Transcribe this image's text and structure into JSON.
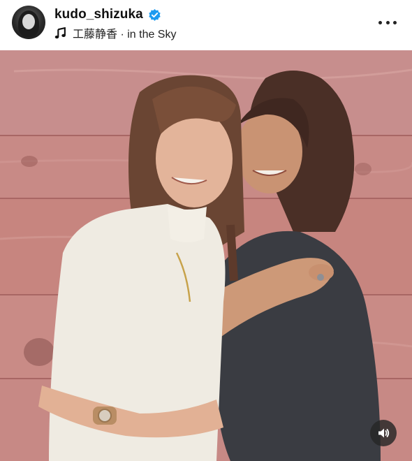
{
  "post": {
    "username": "kudo_shizuka",
    "music": "工藤静香 · in the Sky",
    "verified": true
  },
  "icons": {
    "avatar": "profile-avatar",
    "verified": "verified-badge-icon",
    "music": "music-note-icon",
    "more": "more-options-icon",
    "volume": "volume-icon"
  },
  "colors": {
    "verified": "#1d9bf0",
    "wall": "#c98f8f",
    "volume_bg": "#262626"
  }
}
